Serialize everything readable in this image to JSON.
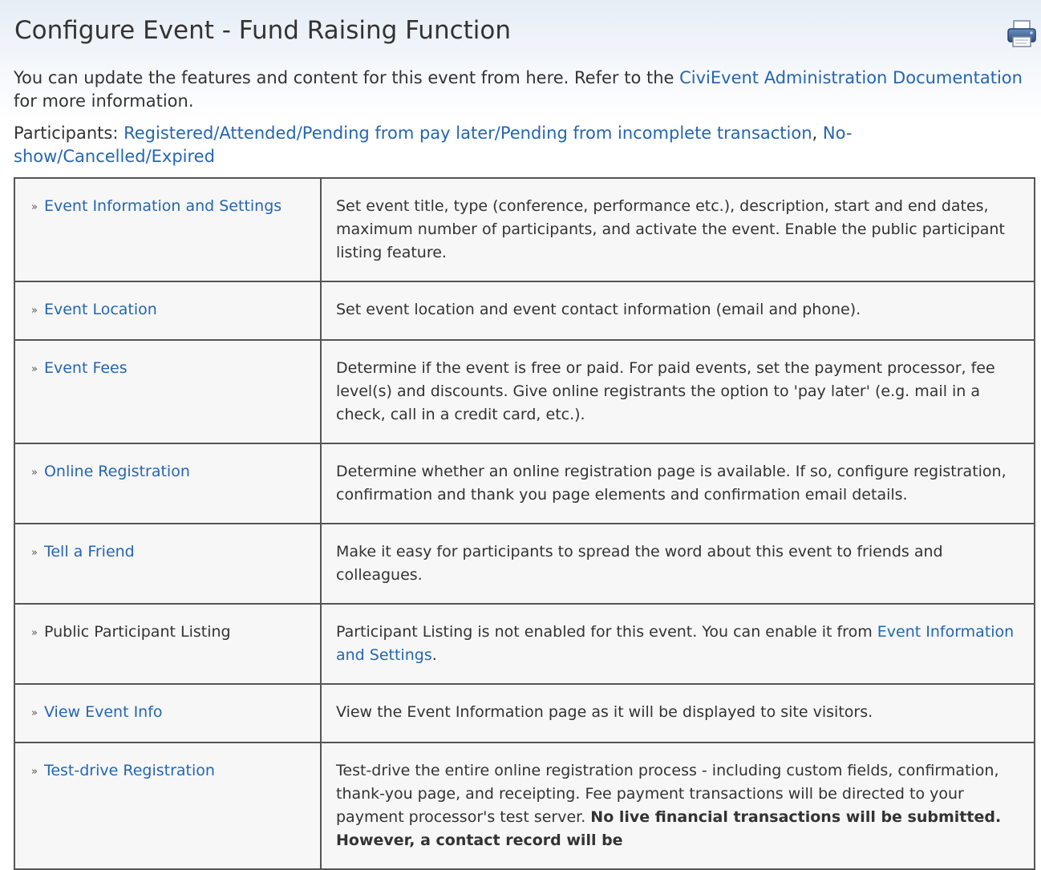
{
  "page": {
    "title": "Configure Event - Fund Raising Function",
    "print_icon": "printer-icon"
  },
  "intro": {
    "text_before": "You can update the features and content for this event from here. Refer to the ",
    "doc_link": "CiviEvent Administration Documentation",
    "text_after": " for more information."
  },
  "participants": {
    "label": "Participants: ",
    "link_1": "Registered/Attended/Pending from pay later/Pending from incomplete transaction",
    "separator": ", ",
    "link_2": "No-show/Cancelled/Expired"
  },
  "rows": [
    {
      "label": "Event Information and Settings",
      "is_link": true,
      "description": "Set event title, type (conference, performance etc.), description, start and end dates, maximum number of participants, and activate the event. Enable the public participant listing feature."
    },
    {
      "label": "Event Location",
      "is_link": true,
      "description": "Set event location and event contact information (email and phone)."
    },
    {
      "label": "Event Fees",
      "is_link": true,
      "description": "Determine if the event is free or paid. For paid events, set the payment processor, fee level(s) and discounts. Give online registrants the option to 'pay later' (e.g. mail in a check, call in a credit card, etc.)."
    },
    {
      "label": "Online Registration",
      "is_link": true,
      "description": "Determine whether an online registration page is available. If so, configure registration, confirmation and thank you page elements and confirmation email details."
    },
    {
      "label": "Tell a Friend",
      "is_link": true,
      "description": "Make it easy for participants to spread the word about this event to friends and colleagues."
    },
    {
      "label": "Public Participant Listing",
      "is_link": false,
      "description_before": "Participant Listing is not enabled for this event. You can enable it from ",
      "description_link": "Event Information and Settings",
      "description_after": "."
    },
    {
      "label": "View Event Info",
      "is_link": true,
      "description": "View the Event Information page as it will be displayed to site visitors."
    },
    {
      "label": "Test-drive Registration",
      "is_link": true,
      "description_before": "Test-drive the entire online registration process - including custom fields, confirmation, thank-you page, and receipting. Fee payment transactions will be directed to your payment processor's test server. ",
      "description_bold": "No live financial transactions will be submitted. However, a contact record will be"
    }
  ],
  "bullet": "»",
  "colors": {
    "link": "#2466b2",
    "text": "#333333",
    "table_bg": "#f7f7f7",
    "border": "#555555"
  }
}
